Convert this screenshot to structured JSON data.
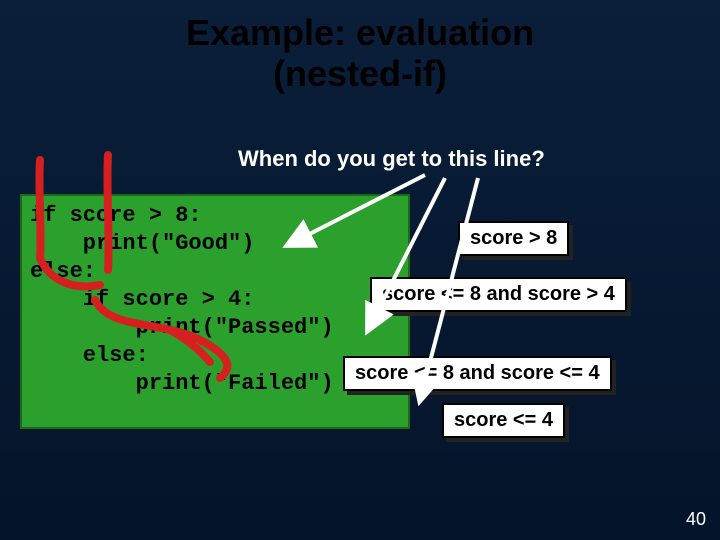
{
  "title_line1": "Example: evaluation",
  "title_line2": "(nested-if)",
  "question": "When do you get to this line?",
  "code": "if score > 8:\n    print(\"Good\")\nelse:\n    if score > 4:\n        print(\"Passed\")\n    else:\n        print(\"Failed\")",
  "cond": {
    "c1": "score > 8",
    "c2": "score <= 8 and score > 4",
    "c3": "score <= 8 and score <= 4",
    "c4": "score <= 4"
  },
  "pagenum": "40"
}
